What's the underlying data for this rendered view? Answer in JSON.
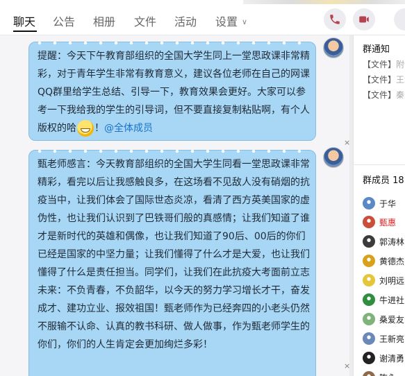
{
  "tabs": [
    {
      "label": "聊天",
      "active": true
    },
    {
      "label": "公告",
      "active": false
    },
    {
      "label": "相册",
      "active": false
    },
    {
      "label": "文件",
      "active": false
    },
    {
      "label": "活动",
      "active": false
    },
    {
      "label": "设置",
      "active": false
    }
  ],
  "messages": [
    {
      "text": "提醒：今天下午教育部组织的全国大学生同上一堂思政课非常精彩，对于青年学生非常有教育意义，建议各位老师在自己的网课QQ群里给学生总结、引导一下，教育效果会更好。大家可以参考一下我给我的学生的引导词，但不要直接复制粘贴啊，有个人版权的哈",
      "after_emoji": "！",
      "mention": "@全体成员"
    },
    {
      "text": "甄老师感言：今天教育部组织的全国大学生同看一堂思政课非常精彩，看完以后让我感触良多，在这场看不见敌人没有硝烟的抗疫当中，让我们体会了国际世态炎凉，看清了西方英美国家的虚伪性，也让我们认识到了巴铁哥们般的真感情；让我们知道了谁才是新时代的英雄和偶像，也让我们知道了90后、00后的你们已经是国家的中坚力量；让我们懂得了什么才是大爱，也让我们懂得了什么是责任担当。同学们，让我们在此抗疫大考面前立志未来：不负青春，不负韶华，以今天的努力学习增长才干，奋发成才、建功立业、报效祖国！甄老师作为已经奔四的小老头仍然不服输不认命、认真的教书科研、做人做事，作为甄老师学生的你们，你们的人生肯定会更加绚烂多彩！"
    }
  ],
  "sidebar": {
    "notice_title": "群通知",
    "notices": [
      {
        "tag": "【文件】",
        "text": "附件"
      },
      {
        "tag": "【文件】",
        "text": "王城"
      },
      {
        "tag": "【文件】",
        "text": "秦重"
      }
    ],
    "members_title": "群成员 18",
    "members": [
      {
        "name": "于华",
        "color": "#5a8ac6",
        "highlight": false
      },
      {
        "name": "甄惠",
        "color": "#c94f3a",
        "highlight": true
      },
      {
        "name": "郭涛林",
        "color": "#3b3b3b",
        "highlight": false
      },
      {
        "name": "黄德杰",
        "color": "#d9a01b",
        "highlight": false
      },
      {
        "name": "刘明远",
        "color": "#e5c53a",
        "highlight": false
      },
      {
        "name": "牛进社",
        "color": "#2f8f3f",
        "highlight": false
      },
      {
        "name": "桑爱友",
        "color": "#7fb37a",
        "highlight": false
      },
      {
        "name": "王新亮",
        "color": "#6a88b8",
        "highlight": false
      },
      {
        "name": "谢清勇",
        "color": "#222222",
        "highlight": false
      },
      {
        "name": "陈永",
        "color": "#8f6a4a",
        "highlight": false
      }
    ]
  }
}
